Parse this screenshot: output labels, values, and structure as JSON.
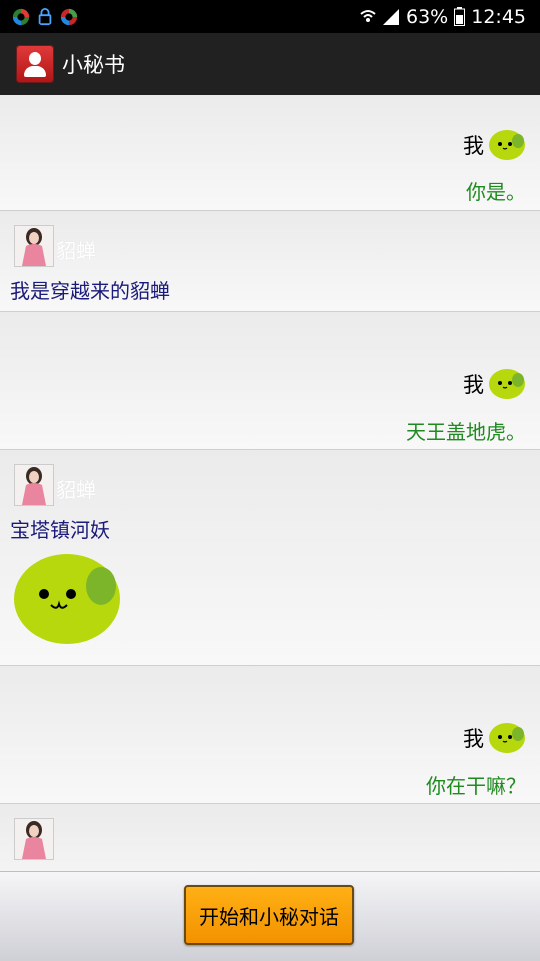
{
  "status_bar": {
    "battery": "63%",
    "time": "12:45",
    "icons": [
      "app-notification-icon",
      "lock-notification-icon",
      "sync-notification-icon",
      "wifi-icon",
      "signal-icon",
      "battery-icon"
    ]
  },
  "action_bar": {
    "title": "小秘书",
    "icon": "contact-icon"
  },
  "messages": [
    {
      "from": "me",
      "name": "我",
      "text": "你是。"
    },
    {
      "from": "bot",
      "name": "貂蝉",
      "text": "我是穿越来的貂蝉"
    },
    {
      "from": "me",
      "name": "我",
      "text": "天王盖地虎。"
    },
    {
      "from": "bot",
      "name": "貂蝉",
      "text": "宝塔镇河妖",
      "sticker": "green-face-sticker"
    },
    {
      "from": "me",
      "name": "我",
      "text": "你在干嘛？"
    },
    {
      "from": "bot",
      "name": "",
      "text": ""
    }
  ],
  "bottom": {
    "start_button_label": "开始和小秘对话"
  },
  "colors": {
    "my_message": "#1f8b1f",
    "bot_message": "#1a1a7a",
    "button": "#f7a20c",
    "action_bar": "#212121"
  }
}
